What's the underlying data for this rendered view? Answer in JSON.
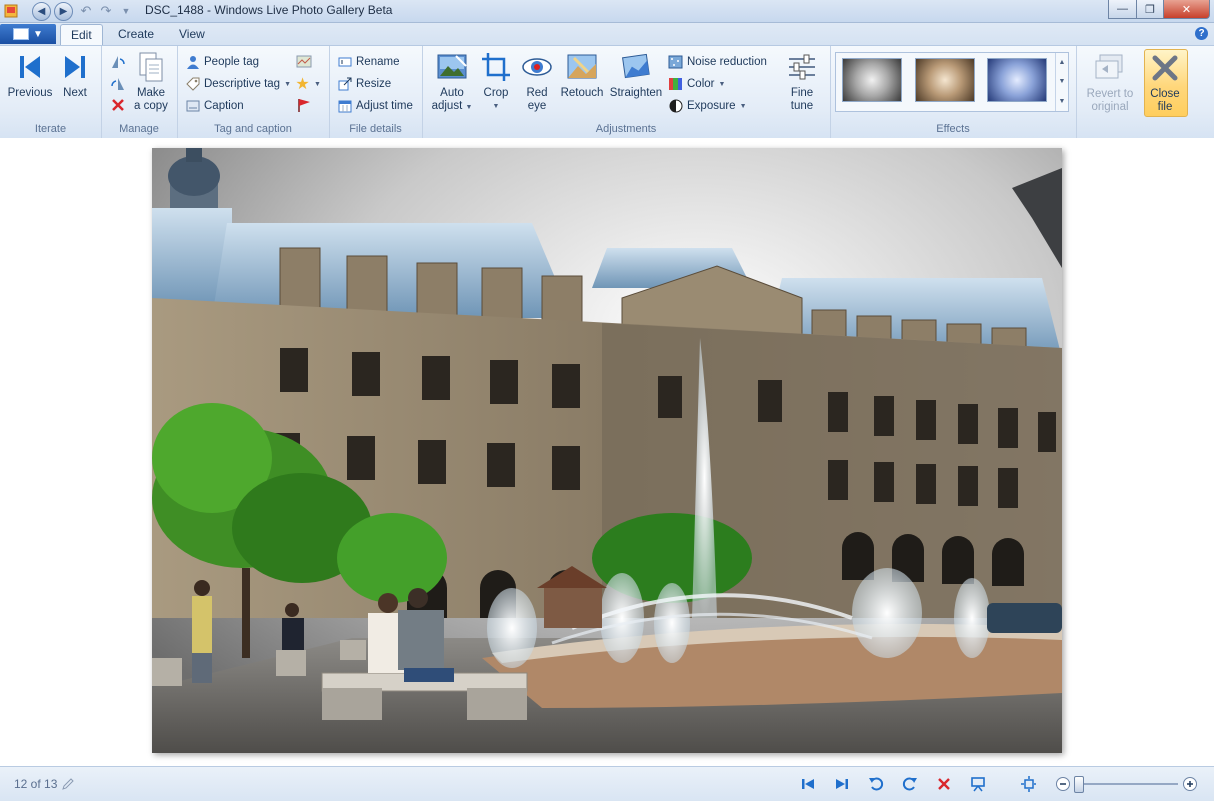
{
  "window": {
    "title": "DSC_1488 - Windows Live Photo Gallery Beta",
    "minimize_glyph": "—",
    "maximize_glyph": "❐",
    "close_glyph": "✕"
  },
  "tabs": [
    {
      "label": "Edit",
      "active": true
    },
    {
      "label": "Create",
      "active": false
    },
    {
      "label": "View",
      "active": false
    }
  ],
  "help_glyph": "?",
  "ribbon": {
    "iterate": {
      "label": "Iterate",
      "previous": "Previous",
      "next": "Next"
    },
    "manage": {
      "label": "Manage",
      "make_copy_1": "Make",
      "make_copy_2": "a copy"
    },
    "tag": {
      "label": "Tag and caption",
      "people_tag": "People tag",
      "descriptive_tag": "Descriptive tag",
      "caption": "Caption"
    },
    "file": {
      "label": "File details",
      "rename": "Rename",
      "resize": "Resize",
      "adjust_time": "Adjust time"
    },
    "adjust": {
      "label": "Adjustments",
      "auto_1": "Auto",
      "auto_2": "adjust",
      "crop": "Crop",
      "red_1": "Red",
      "red_2": "eye",
      "retouch": "Retouch",
      "straighten": "Straighten",
      "noise": "Noise reduction",
      "color": "Color",
      "exposure": "Exposure",
      "fine_1": "Fine",
      "fine_2": "tune"
    },
    "effects": {
      "label": "Effects"
    },
    "revert_1": "Revert to",
    "revert_2": "original",
    "close_1": "Close",
    "close_2": "file"
  },
  "status": {
    "counter": "12 of 13"
  },
  "colors": {
    "accent_blue": "#1f6fcc",
    "delete_red": "#d9262c",
    "close_highlight": "#ffd77b"
  }
}
